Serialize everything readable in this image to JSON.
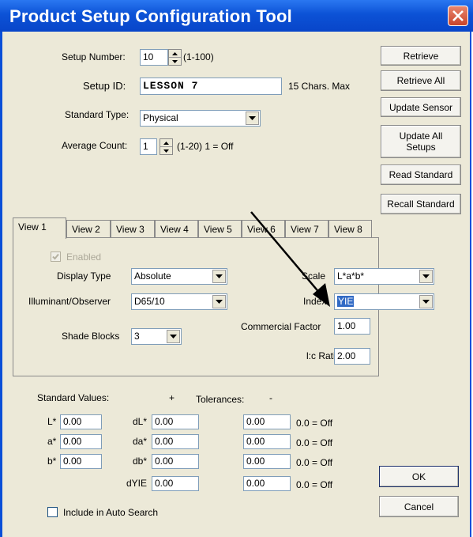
{
  "window": {
    "title": "Product Setup Configuration Tool"
  },
  "setup": {
    "number_label": "Setup Number:",
    "number_value": "10",
    "number_range": "(1-100)",
    "id_label": "Setup ID:",
    "id_value": "LESSON 7",
    "id_hint": "15 Chars. Max",
    "standard_type_label": "Standard Type:",
    "standard_type_value": "Physical",
    "average_count_label": "Average Count:",
    "average_count_value": "1",
    "average_count_hint": "(1-20) 1 = Off"
  },
  "buttons": {
    "retrieve": "Retrieve",
    "retrieve_all": "Retrieve All",
    "update_sensor": "Update Sensor",
    "update_all_setups_1": "Update All",
    "update_all_setups_2": "Setups",
    "read_standard": "Read Standard",
    "recall_standard": "Recall Standard",
    "ok": "OK",
    "cancel": "Cancel"
  },
  "tabs": [
    "View 1",
    "View 2",
    "View 3",
    "View 4",
    "View 5",
    "View 6",
    "View 7",
    "View 8"
  ],
  "view": {
    "enabled_label": "Enabled",
    "display_type_label": "Display Type",
    "display_type_value": "Absolute",
    "illuminant_label": "Illuminant/Observer",
    "illuminant_value": "D65/10",
    "shade_blocks_label": "Shade Blocks",
    "shade_blocks_value": "3",
    "scale_label": "Scale",
    "scale_value": "L*a*b*",
    "index_label": "Index",
    "index_value": "YIE",
    "commercial_factor_label": "Commercial Factor",
    "commercial_factor_value": "1.00",
    "lc_ratio_label": "l:c Ratio",
    "lc_ratio_value": "2.00"
  },
  "standards": {
    "values_label": "Standard Values:",
    "plus": "+",
    "tolerances_label": "Tolerances:",
    "minus": "-",
    "off_hint": "0.0 = Off",
    "rows": [
      {
        "label": "L*",
        "value": "0.00",
        "delta_label": "dL*",
        "delta": "0.00",
        "tol": "0.00"
      },
      {
        "label": "a*",
        "value": "0.00",
        "delta_label": "da*",
        "delta": "0.00",
        "tol": "0.00"
      },
      {
        "label": "b*",
        "value": "0.00",
        "delta_label": "db*",
        "delta": "0.00",
        "tol": "0.00"
      },
      {
        "label": "",
        "value": "",
        "delta_label": "dYIE",
        "delta": "0.00",
        "tol": "0.00"
      }
    ],
    "include_auto_search": "Include in Auto Search"
  }
}
